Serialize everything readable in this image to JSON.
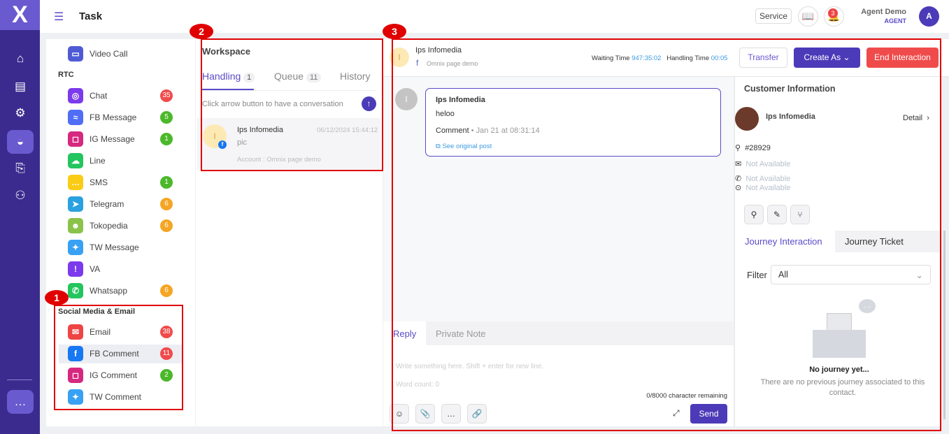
{
  "header": {
    "title": "Task",
    "service_label": "Service",
    "notif_count": "3",
    "user_name": "Agent Demo",
    "user_role": "AGENT",
    "avatar_letter": "A"
  },
  "channels": {
    "video_call": "Video Call",
    "rtc_title": "RTC",
    "rtc": [
      {
        "label": "Chat",
        "icon": "globe-icon",
        "color": "#7c3aed",
        "count": "35",
        "badge": "#f04b4b"
      },
      {
        "label": "FB Message",
        "icon": "messenger-icon",
        "color": "#4f6df5",
        "count": "5",
        "badge": "#4bb82a"
      },
      {
        "label": "IG Message",
        "icon": "instagram-icon",
        "color": "#d6287e",
        "count": "1",
        "badge": "#4bb82a"
      },
      {
        "label": "Line",
        "icon": "line-icon",
        "color": "#22c55e",
        "count": "",
        "badge": ""
      },
      {
        "label": "SMS",
        "icon": "sms-icon",
        "color": "#facc15",
        "count": "1",
        "badge": "#4bb82a"
      },
      {
        "label": "Telegram",
        "icon": "telegram-icon",
        "color": "#2aa1e0",
        "count": "6",
        "badge": "#f5a524"
      },
      {
        "label": "Tokopedia",
        "icon": "tokopedia-icon",
        "color": "#8bc34a",
        "count": "6",
        "badge": "#f5a524"
      },
      {
        "label": "TW Message",
        "icon": "twitter-icon",
        "color": "#38a1f3",
        "count": "",
        "badge": ""
      },
      {
        "label": "VA",
        "icon": "warning-icon",
        "color": "#7c3aed",
        "count": "",
        "badge": ""
      },
      {
        "label": "Whatsapp",
        "icon": "whatsapp-icon",
        "color": "#22c55e",
        "count": "6",
        "badge": "#f5a524"
      }
    ],
    "social_title": "Social Media & Email",
    "social": [
      {
        "label": "Email",
        "icon": "email-icon",
        "color": "#ef4444",
        "count": "38",
        "badge": "#f04b4b"
      },
      {
        "label": "FB Comment",
        "icon": "facebook-icon",
        "color": "#1877f2",
        "count": "11",
        "badge": "#f04b4b"
      },
      {
        "label": "IG Comment",
        "icon": "instagram-icon",
        "color": "#d6287e",
        "count": "2",
        "badge": "#4bb82a"
      },
      {
        "label": "TW Comment",
        "icon": "twitter-icon",
        "color": "#38a1f3",
        "count": "",
        "badge": ""
      }
    ]
  },
  "workspace": {
    "title": "Workspace",
    "tabs": [
      {
        "label": "Handling",
        "count": "1"
      },
      {
        "label": "Queue",
        "count": "11"
      },
      {
        "label": "History"
      }
    ],
    "hint": "Click arrow button to have a conversation",
    "item": {
      "avatar": "I",
      "name": "Ips Infomedia",
      "time": "06/12/2024 15:44:12",
      "msg": "pic",
      "account": "Account : Omnix page demo"
    }
  },
  "interaction": {
    "name": "Ips Infomedia",
    "page": "Omnix page demo",
    "avatar": "I",
    "waiting_label": "Waiting Time",
    "waiting": "947:35:02",
    "handling_label": "Handling Time",
    "handling": "00:05",
    "transfer": "Transfer",
    "create_as": "Create As",
    "end": "End Interaction",
    "message": {
      "author": "Ips Infomedia",
      "text": "heloo",
      "type": "Comment",
      "time": "• Jan 21 at 08:31:14",
      "link": "See original post"
    },
    "reply_tabs": [
      "Reply",
      "Private Note"
    ],
    "placeholder": "Write something here. Shift + enter for new line.",
    "word_count": "Word count: 0",
    "remaining": "0/8000 character remaining",
    "send": "Send"
  },
  "customer": {
    "title": "Customer Information",
    "name": "Ips Infomedia",
    "detail": "Detail",
    "id": "#28929",
    "email": "Not Available",
    "phone": "Not Available",
    "address": "Not Available",
    "tabs": [
      "Journey Interaction",
      "Journey Ticket"
    ],
    "filter_label": "Filter",
    "filter_value": "All",
    "empty_title": "No journey yet...",
    "empty_text": "There are no previous journey associated to this contact."
  },
  "annotations": [
    "1",
    "2",
    "3"
  ]
}
